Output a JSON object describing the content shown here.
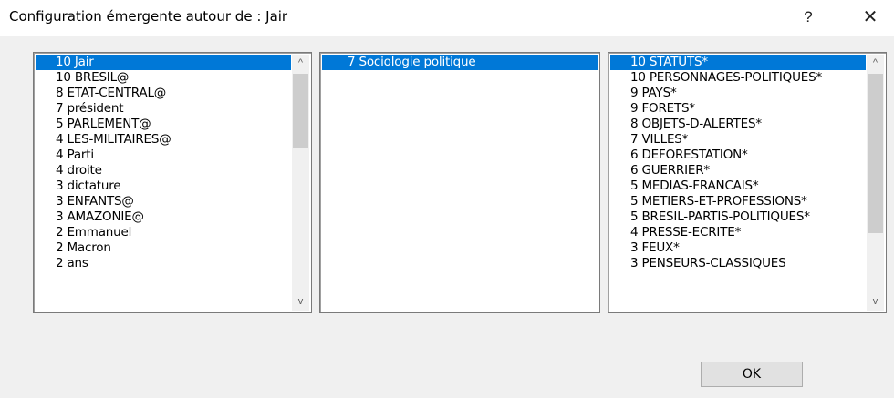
{
  "window": {
    "title": "Configuration émergente autour de : Jair",
    "help_label": "?",
    "close_label": "✕"
  },
  "left_list": {
    "items": [
      "10 Jair",
      "10 BRESIL@",
      "8 ETAT-CENTRAL@",
      "7 président",
      "5 PARLEMENT@",
      "4 LES-MILITAIRES@",
      "4 Parti",
      "4 droite",
      "3 dictature",
      "3 ENFANTS@",
      "3 AMAZONIE@",
      "2 Emmanuel",
      "2 Macron",
      "2 ans"
    ],
    "selected_index": 0
  },
  "middle_list": {
    "items": [
      "7 Sociologie politique"
    ],
    "selected_index": 0
  },
  "right_list": {
    "items": [
      "10 STATUTS*",
      "10 PERSONNAGES-POLITIQUES*",
      "9 PAYS*",
      "9 FORETS*",
      "8 OBJETS-D-ALERTES*",
      "7 VILLES*",
      "6 DEFORESTATION*",
      "6 GUERRIER*",
      "5 MEDIAS-FRANCAIS*",
      "5 METIERS-ET-PROFESSIONS*",
      "5 BRESIL-PARTIS-POLITIQUES*",
      "4 PRESSE-ECRITE*",
      "3 FEUX*",
      "3 PENSEURS-CLASSIQUES"
    ],
    "selected_index": 0
  },
  "scroll_icons": {
    "up": "^",
    "down": "v"
  },
  "buttons": {
    "ok_label": "OK"
  }
}
